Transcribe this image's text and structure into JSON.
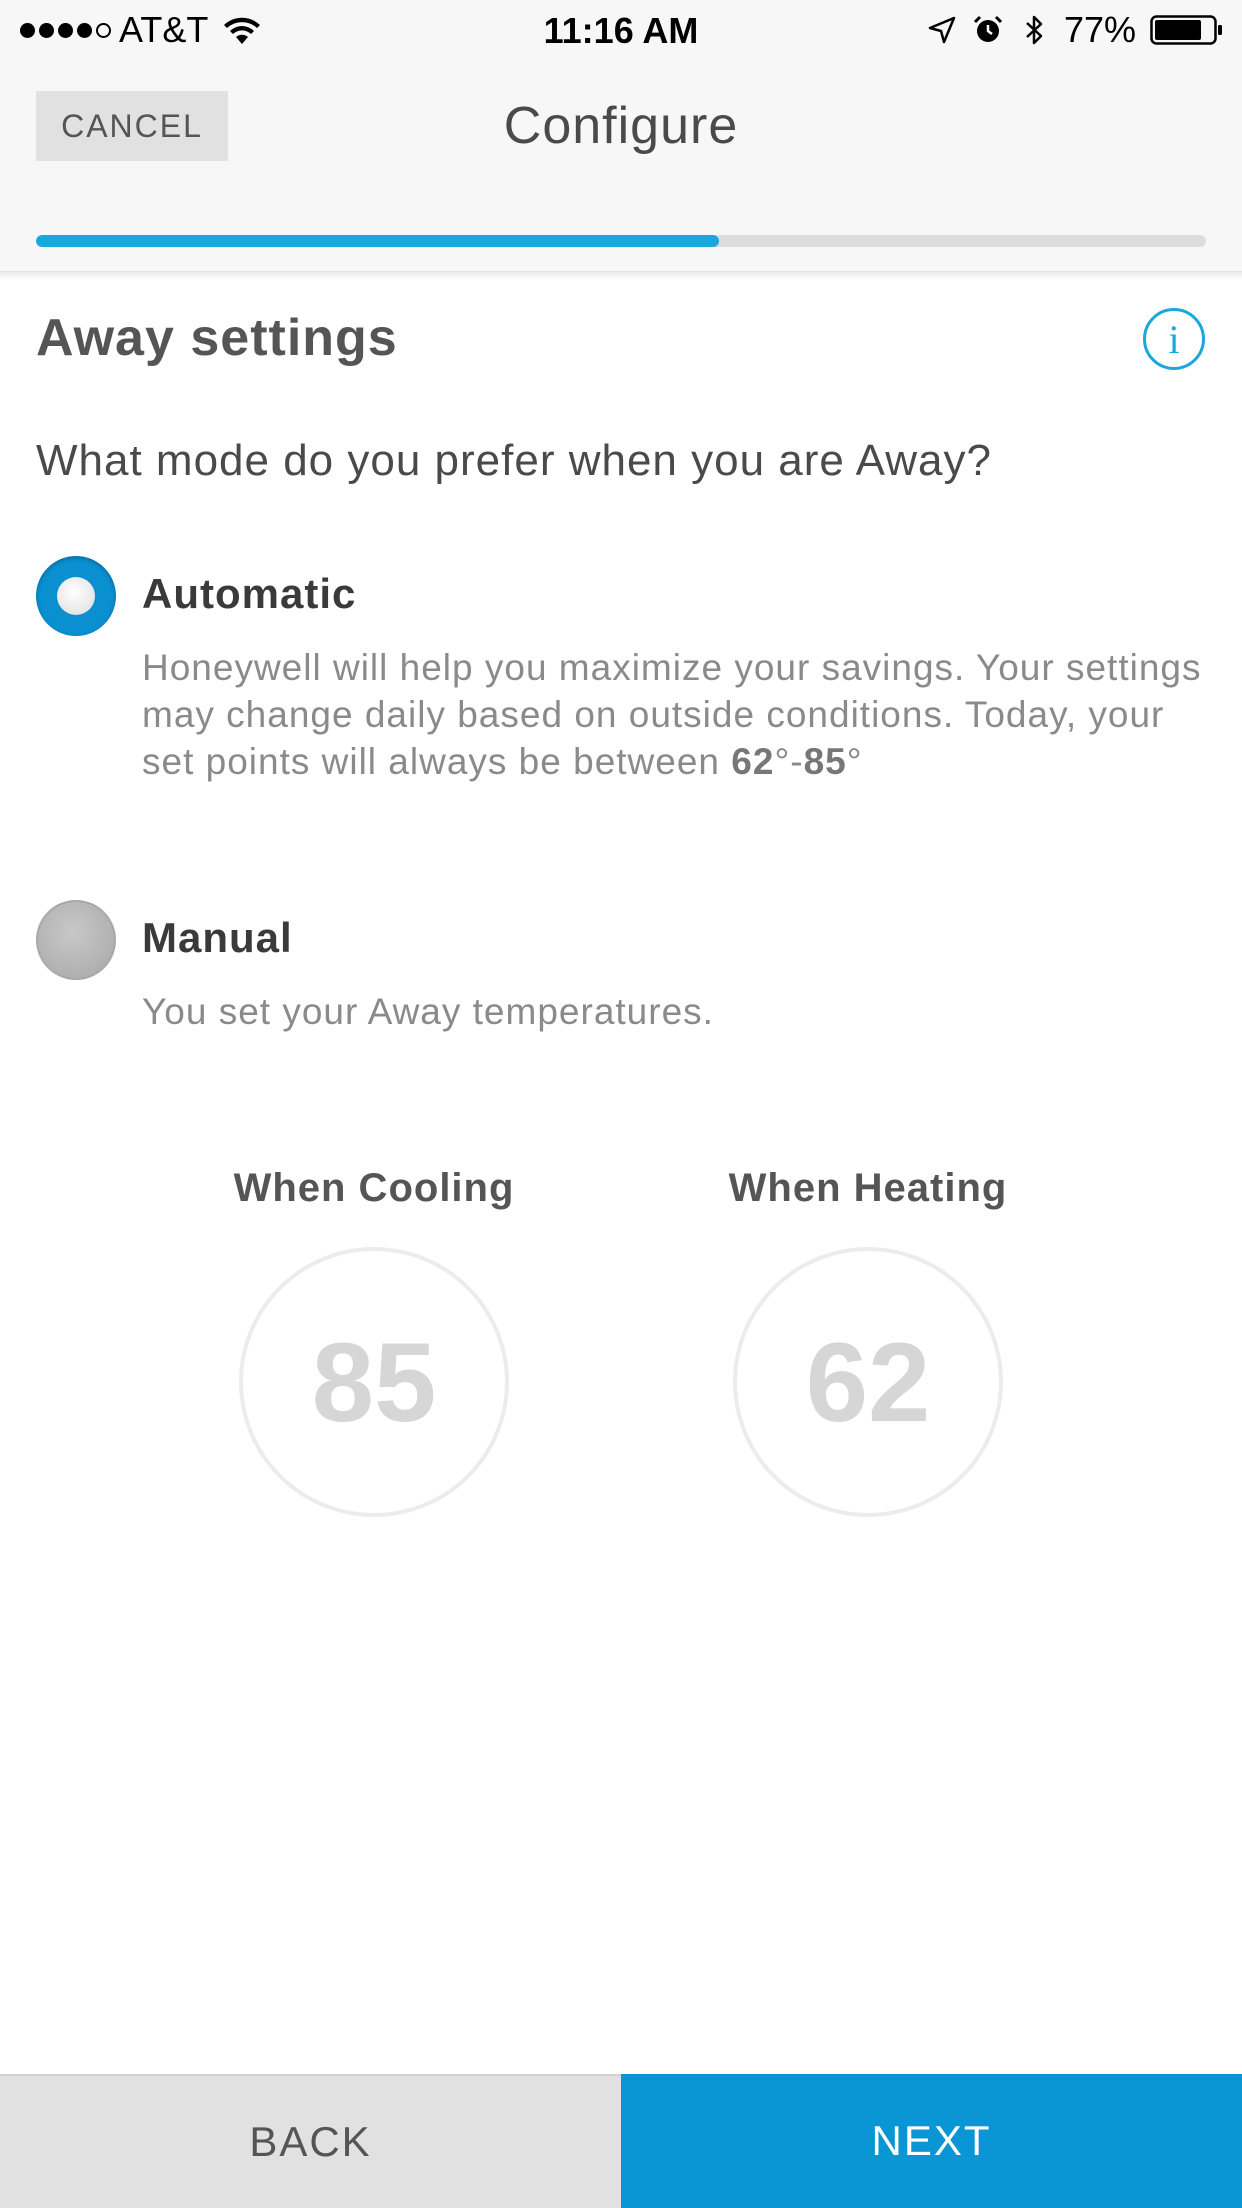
{
  "status_bar": {
    "carrier": "AT&T",
    "time": "11:16 AM",
    "battery": "77%",
    "signal_bars_filled": 4,
    "signal_bars_total": 5
  },
  "header": {
    "cancel_label": "CANCEL",
    "title": "Configure",
    "progress_percent": 58.4
  },
  "content": {
    "section_title": "Away settings",
    "info_label": "i",
    "question": "What mode do you prefer when you are Away?",
    "options": [
      {
        "label": "Automatic",
        "selected": true,
        "description_prefix": "Honeywell will help you maximize your savings. Your settings may change daily based on outside conditions. Today, your set points will always be between ",
        "range_low": "62",
        "range_sep": "°-",
        "range_high": "85",
        "range_suffix": "°"
      },
      {
        "label": "Manual",
        "selected": false,
        "description": "You set your Away temperatures."
      }
    ],
    "cooling": {
      "label": "When Cooling",
      "value": "85"
    },
    "heating": {
      "label": "When Heating",
      "value": "62"
    }
  },
  "footer": {
    "back_label": "BACK",
    "next_label": "NEXT"
  },
  "colors": {
    "accent": "#1aa7dd",
    "primary_button": "#0a96d5",
    "radio_selected": "#0a8fd0"
  },
  "icons": [
    "wifi-icon",
    "location-icon",
    "alarm-icon",
    "bluetooth-icon",
    "battery-icon",
    "info-icon"
  ]
}
